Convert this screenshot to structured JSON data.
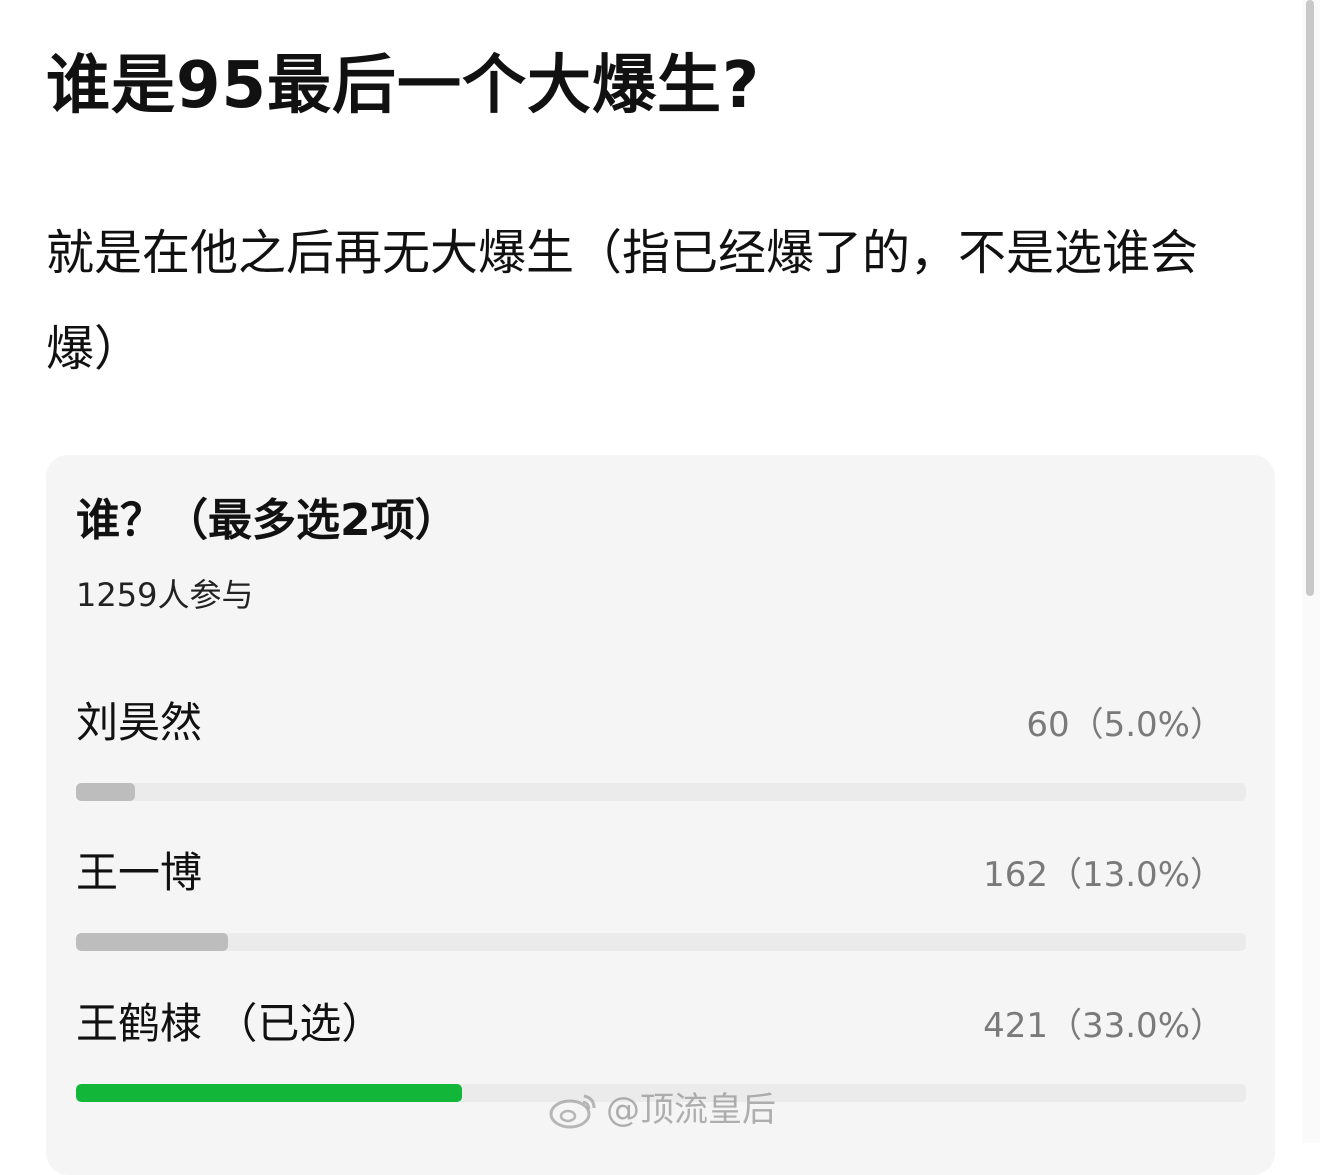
{
  "post": {
    "title": "谁是95最后一个大爆生?",
    "description": "就是在他之后再无大爆生（指已经爆了的，不是选谁会爆）"
  },
  "poll": {
    "question": "谁？（最多选2项）",
    "participants": "1259人参与",
    "options": [
      {
        "label": "刘昊然",
        "result": "60（5.0%）",
        "percent": 5.0,
        "selected": false
      },
      {
        "label": "王一博",
        "result": "162（13.0%）",
        "percent": 13.0,
        "selected": false
      },
      {
        "label": "王鹤棣 （已选）",
        "result": "421（33.0%）",
        "percent": 33.0,
        "selected": true
      }
    ]
  },
  "colors": {
    "selected_bar": "#12b73a",
    "unselected_bar": "#bdbdbd",
    "track": "#ebebeb",
    "card_background": "#f5f5f5"
  },
  "watermark": {
    "icon": "weibo-logo-icon",
    "text": "@顶流皇后"
  }
}
